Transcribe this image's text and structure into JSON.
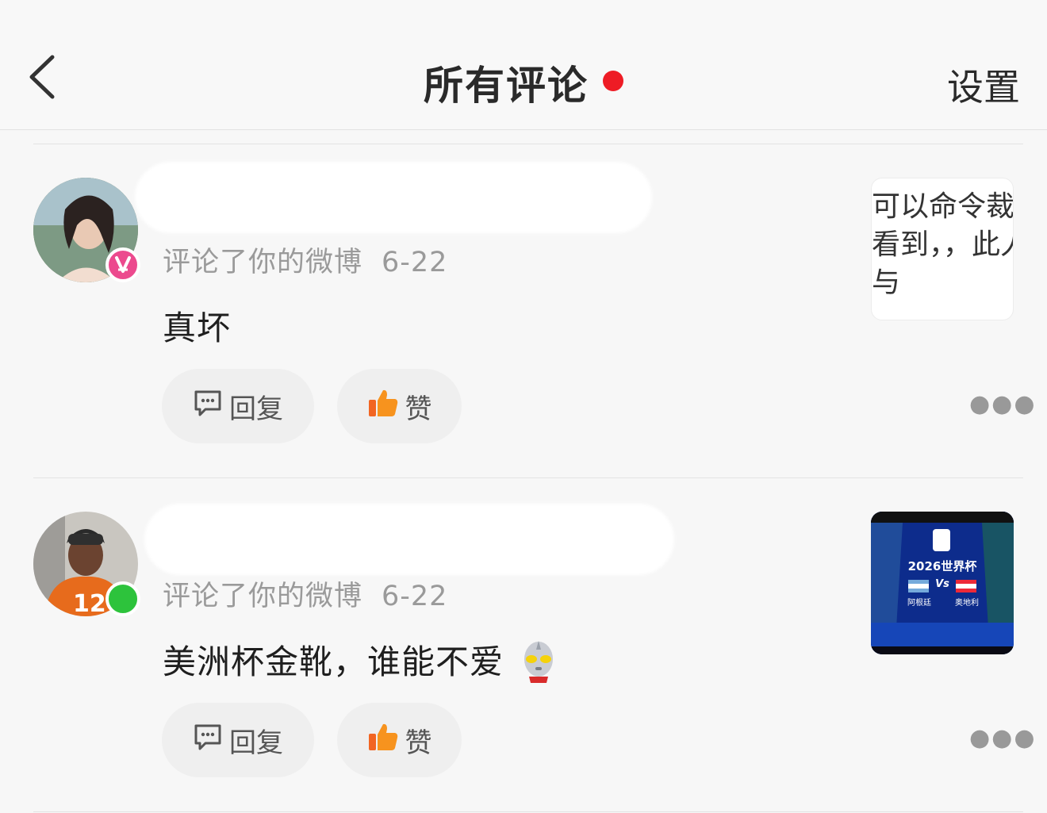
{
  "header": {
    "title": "所有评论",
    "settings_label": "设置",
    "back_icon": "chevron-left-icon",
    "dot_color": "#ee1c25"
  },
  "comments": [
    {
      "meta": "评论了你的微博",
      "date": "6-22",
      "content": "真坏",
      "reply_label": "回复",
      "like_label": "赞",
      "avatar_badge_color": "#ec4a8e",
      "thumb_text_lines": [
        "可以命令裁",
        "看到，，此人",
        "与"
      ]
    },
    {
      "meta": "评论了你的微博",
      "date": "6-22",
      "content": "美洲杯金靴，谁能不爱",
      "reply_label": "回复",
      "like_label": "赞",
      "avatar_badge_color": "#2dc33c",
      "thumb": {
        "title": "2026世界杯",
        "vs": "Vs",
        "team_left": "阿根廷",
        "team_right": "奥地利"
      }
    }
  ]
}
